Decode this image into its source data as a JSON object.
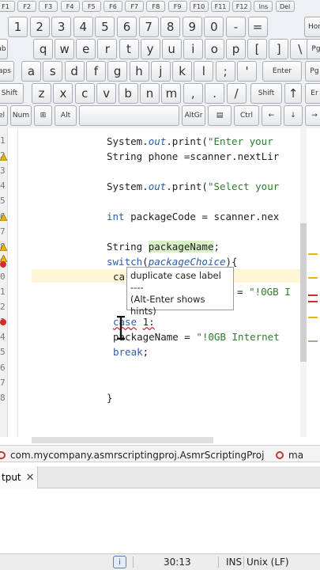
{
  "keyboard": {
    "function_row": [
      "F1",
      "F2",
      "F3",
      "F4",
      "F5",
      "F6",
      "F7",
      "F8",
      "F9",
      "F10",
      "F11",
      "F12",
      "Ins",
      "Del"
    ],
    "number_row": [
      "1",
      "2",
      "3",
      "4",
      "5",
      "6",
      "7",
      "8",
      "9",
      "0",
      "-",
      "="
    ],
    "number_row_right": "Hon",
    "qwerty_row": [
      "ab",
      "q",
      "w",
      "e",
      "r",
      "t",
      "y",
      "u",
      "i",
      "o",
      "p",
      "[",
      "]",
      "\\"
    ],
    "qwerty_row_right": "Pg",
    "home_row": [
      "aps",
      "a",
      "s",
      "d",
      "f",
      "g",
      "h",
      "j",
      "k",
      "l",
      ";",
      "'",
      "Enter"
    ],
    "home_row_right": "Pg",
    "shift_row": [
      "Shift",
      "z",
      "x",
      "c",
      "v",
      "b",
      "n",
      "m",
      ",",
      ".",
      "/",
      "Shift",
      "↑"
    ],
    "shift_row_right": "Er",
    "bottom_row": [
      "el",
      "Num",
      "⊞",
      "Alt",
      "",
      "AltGr",
      "▤",
      "Ctrl",
      "←",
      "↓",
      "→"
    ]
  },
  "editor": {
    "code_lines": [
      {
        "parts": [
          {
            "t": "System."
          },
          {
            "t": "out",
            "c": "it"
          },
          {
            "t": ".print("
          },
          {
            "t": "\"Enter your",
            "c": "st"
          }
        ]
      },
      {
        "parts": [
          {
            "t": "String phone =scanner.nextLir"
          }
        ]
      },
      {
        "parts": [
          {
            "t": "System."
          },
          {
            "t": "out",
            "c": "it"
          },
          {
            "t": ".print("
          },
          {
            "t": "\"Select your",
            "c": "st"
          }
        ]
      },
      {
        "parts": [
          {
            "t": "int",
            "c": "kw"
          },
          {
            "t": " packageCode = scanner.nex"
          }
        ]
      },
      {
        "parts": [
          {
            "t": "String "
          },
          {
            "t": "packageName",
            "c": "hl"
          },
          {
            "t": ";"
          }
        ]
      },
      {
        "parts": [
          {
            "t": "switch",
            "c": "kw"
          },
          {
            "t": "("
          },
          {
            "t": "packageChoice",
            "c": "it"
          },
          {
            "t": "){"
          }
        ]
      },
      {
        "parts": [
          {
            "t": "ca"
          }
        ]
      },
      {
        "parts": [
          {
            "t": "= "
          },
          {
            "t": "\"!0GB I",
            "c": "st"
          }
        ]
      },
      {
        "parts": [
          {
            "t": "case",
            "c": "kw und"
          },
          {
            "t": " "
          },
          {
            "t": "1:",
            "c": "und"
          }
        ]
      },
      {
        "parts": [
          {
            "t": "packageName = "
          },
          {
            "t": "\"!0GB Internet",
            "c": "st"
          }
        ]
      },
      {
        "parts": [
          {
            "t": "break",
            "c": "kw"
          },
          {
            "t": ";"
          }
        ]
      },
      {
        "parts": [
          {
            "t": "}"
          }
        ]
      }
    ],
    "line_numbers": [
      "1",
      "2",
      "3",
      "4",
      "5",
      "6",
      "7",
      "8",
      "9",
      "0",
      "1",
      "2",
      "3",
      "4",
      "5",
      "6",
      "7",
      "8"
    ],
    "tooltip": {
      "line1": "duplicate case label",
      "line2": "----",
      "line3": "(Alt-Enter shows hints)"
    }
  },
  "editor_tabs": [
    {
      "label": "com.mycompany.asmrscriptingproj.AsmrScriptingProj"
    },
    {
      "label": "ma"
    }
  ],
  "output": {
    "tab_label": "tput",
    "close_glyph": "✕"
  },
  "statusbar": {
    "position": "30:13",
    "insert_mode": "INS",
    "line_ending": "Unix (LF)"
  },
  "colors": {
    "keyword": "#2b5fa8",
    "string": "#2c7e2c",
    "error": "#d62b2b",
    "warning": "#e8b400"
  }
}
